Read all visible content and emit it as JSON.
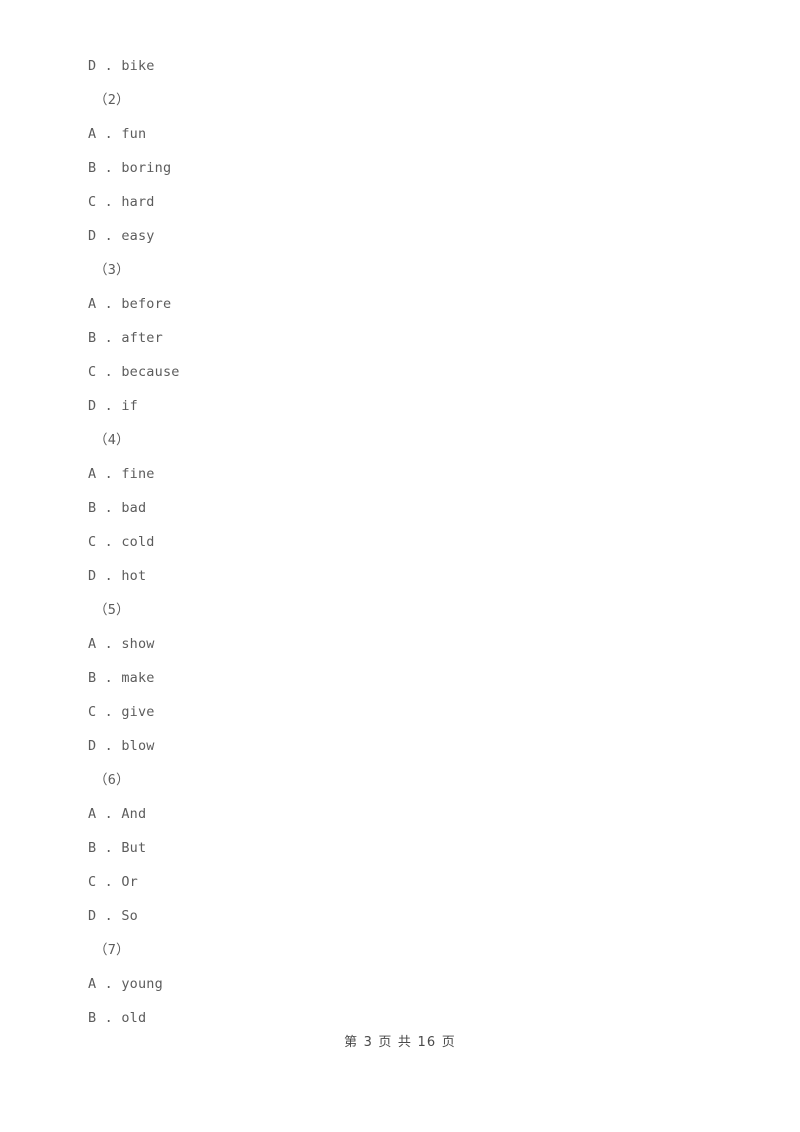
{
  "document": {
    "page_background": "#ffffff",
    "text_color": "#5c5c5c",
    "lines": [
      {
        "kind": "option",
        "letter": "D",
        "separator": " . ",
        "text": "bike"
      },
      {
        "kind": "group",
        "text": "（2）"
      },
      {
        "kind": "option",
        "letter": "A",
        "separator": " . ",
        "text": "fun"
      },
      {
        "kind": "option",
        "letter": "B",
        "separator": " . ",
        "text": "boring"
      },
      {
        "kind": "option",
        "letter": "C",
        "separator": " . ",
        "text": "hard"
      },
      {
        "kind": "option",
        "letter": "D",
        "separator": " . ",
        "text": "easy"
      },
      {
        "kind": "group",
        "text": "（3）"
      },
      {
        "kind": "option",
        "letter": "A",
        "separator": " . ",
        "text": "before"
      },
      {
        "kind": "option",
        "letter": "B",
        "separator": " . ",
        "text": "after"
      },
      {
        "kind": "option",
        "letter": "C",
        "separator": " . ",
        "text": "because"
      },
      {
        "kind": "option",
        "letter": "D",
        "separator": " . ",
        "text": "if"
      },
      {
        "kind": "group",
        "text": "（4）"
      },
      {
        "kind": "option",
        "letter": "A",
        "separator": " . ",
        "text": "fine"
      },
      {
        "kind": "option",
        "letter": "B",
        "separator": " . ",
        "text": "bad"
      },
      {
        "kind": "option",
        "letter": "C",
        "separator": " . ",
        "text": "cold"
      },
      {
        "kind": "option",
        "letter": "D",
        "separator": " . ",
        "text": "hot"
      },
      {
        "kind": "group",
        "text": "（5）"
      },
      {
        "kind": "option",
        "letter": "A",
        "separator": " . ",
        "text": "show"
      },
      {
        "kind": "option",
        "letter": "B",
        "separator": " . ",
        "text": "make"
      },
      {
        "kind": "option",
        "letter": "C",
        "separator": " . ",
        "text": "give"
      },
      {
        "kind": "option",
        "letter": "D",
        "separator": " . ",
        "text": "blow"
      },
      {
        "kind": "group",
        "text": "（6）"
      },
      {
        "kind": "option",
        "letter": "A",
        "separator": " . ",
        "text": "And"
      },
      {
        "kind": "option",
        "letter": "B",
        "separator": " . ",
        "text": "But"
      },
      {
        "kind": "option",
        "letter": "C",
        "separator": " . ",
        "text": "Or"
      },
      {
        "kind": "option",
        "letter": "D",
        "separator": " . ",
        "text": "So"
      },
      {
        "kind": "group",
        "text": "（7）"
      },
      {
        "kind": "option",
        "letter": "A",
        "separator": " . ",
        "text": "young"
      },
      {
        "kind": "option",
        "letter": "B",
        "separator": " . ",
        "text": "old"
      }
    ]
  },
  "footer": {
    "text": "第 3 页 共 16 页",
    "current_page": "3",
    "total_pages": "16"
  }
}
